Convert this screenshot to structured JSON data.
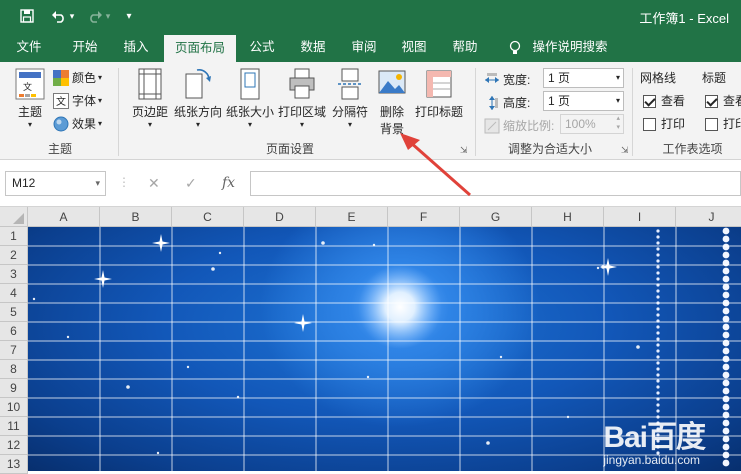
{
  "title_bar": {
    "app_title": "工作簿1  -  Excel"
  },
  "tabs": [
    "文件",
    "开始",
    "插入",
    "页面布局",
    "公式",
    "数据",
    "审阅",
    "视图",
    "帮助"
  ],
  "active_tab": "页面布局",
  "tell_me": "操作说明搜索",
  "ribbon": {
    "theme_group": {
      "themes_label": "主题",
      "colors_label": "颜色",
      "fonts_label": "字体",
      "effects_label": "效果",
      "group_label": "主题"
    },
    "page_setup": {
      "margins": "页边距",
      "orientation": "纸张方向",
      "size": "纸张大小",
      "print_area": "打印区域",
      "breaks": "分隔符",
      "background_line1": "删除",
      "background_line2": "背景",
      "print_titles": "打印标题",
      "group_label": "页面设置"
    },
    "scale_to_fit": {
      "width_label": "宽度:",
      "width_value": "1 页",
      "height_label": "高度:",
      "height_value": "1 页",
      "scale_label": "缩放比例:",
      "scale_value": "100%",
      "group_label": "调整为合适大小"
    },
    "sheet_options": {
      "gridlines_label": "网格线",
      "headings_label": "标题",
      "view_label": "查看",
      "print_label": "打印",
      "view_label_2": "查看",
      "print_label_2": "打印",
      "group_label": "工作表选项"
    }
  },
  "formula_bar": {
    "name_box": "M12",
    "fx": "fx",
    "cancel": "✕",
    "enter": "✓"
  },
  "columns": [
    "A",
    "B",
    "C",
    "D",
    "E",
    "F",
    "G",
    "H",
    "I",
    "J"
  ],
  "rows": [
    "1",
    "2",
    "3",
    "4",
    "5",
    "6",
    "7",
    "8",
    "9",
    "10",
    "11",
    "12",
    "13"
  ],
  "watermark": {
    "brand": "Bai百度",
    "sub": "jingyan.baidu.com"
  },
  "colors": {
    "excel_green": "#217346",
    "arrow_red": "#e0423a",
    "sheet_bg": "#1257b8"
  }
}
